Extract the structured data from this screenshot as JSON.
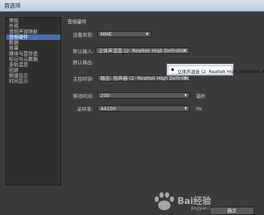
{
  "window": {
    "title": "首选项"
  },
  "sidebar": {
    "items": [
      {
        "label": "常规"
      },
      {
        "label": "外观"
      },
      {
        "label": "音频声道映射"
      },
      {
        "label": "音频硬件"
      },
      {
        "label": "数据"
      },
      {
        "label": "效果"
      },
      {
        "label": "媒体与暂存盘"
      },
      {
        "label": "标记与元数据"
      },
      {
        "label": "多轨混音"
      },
      {
        "label": "回放"
      },
      {
        "label": "频谱显示"
      },
      {
        "label": "时间显示"
      }
    ],
    "selected_index": 3
  },
  "panel": {
    "section_title": "音频硬件",
    "device_type": {
      "label": "设备类型:",
      "value": "MME"
    },
    "default_input": {
      "label": "默认输入:",
      "value": "立体声混音 (2- Realtek High Definitio..."
    },
    "default_output": {
      "label": "默认输出:"
    },
    "master_clock": {
      "label": "主控时钟:",
      "value": "输出: 扬声器 (2- Realtek High Definition A..."
    },
    "latency": {
      "label": "等待时间:",
      "value": "200",
      "unit": "毫秒"
    },
    "sample_rate": {
      "label": "采样率:",
      "value": "44100",
      "unit": "Hz"
    }
  },
  "popup": {
    "option": "立体声混音 (2- Realtek High Definition Audio)"
  },
  "buttons": {
    "ok": "确定"
  },
  "watermark": {
    "text": "Bai经验",
    "url": "jingyan.baidu.com"
  }
}
